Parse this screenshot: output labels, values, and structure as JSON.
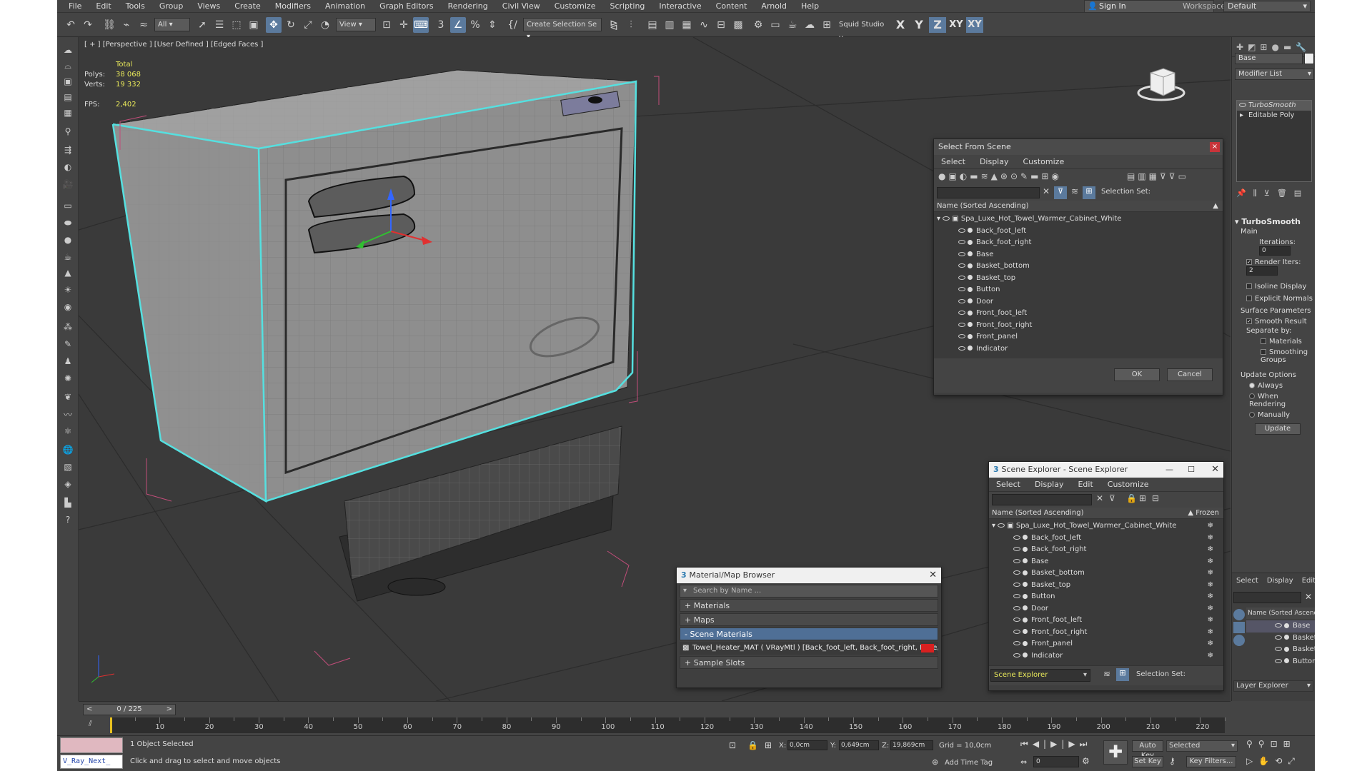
{
  "menu": [
    "File",
    "Edit",
    "Tools",
    "Group",
    "Views",
    "Create",
    "Modifiers",
    "Animation",
    "Graph Editors",
    "Rendering",
    "Civil View",
    "Customize",
    "Scripting",
    "Interactive",
    "Content",
    "Arnold",
    "Help"
  ],
  "signin": "Sign In",
  "workspaces": {
    "label": "Workspaces:",
    "value": "Default"
  },
  "toolbar": {
    "filter": "All",
    "refcoord": "View",
    "selection_set": "Create Selection Se",
    "squid": "Squid Studio v",
    "axes": [
      "X",
      "Y",
      "Z",
      "XY",
      "XY"
    ]
  },
  "viewport": {
    "label": "[ + ] [Perspective ] [User Defined ] [Edged Faces ]",
    "stats": {
      "total_label": "Total",
      "polys_label": "Polys:",
      "polys": "38 068",
      "verts_label": "Verts:",
      "verts": "19 332",
      "fps_label": "FPS:",
      "fps": "2,402"
    }
  },
  "select_from_scene": {
    "title": "Select From Scene",
    "menu": [
      "Select",
      "Display",
      "Customize"
    ],
    "selection_set_label": "Selection Set:",
    "column": "Name (Sorted Ascending)",
    "root": "Spa_Luxe_Hot_Towel_Warmer_Cabinet_White",
    "items": [
      "Back_foot_left",
      "Back_foot_right",
      "Base",
      "Basket_bottom",
      "Basket_top",
      "Button",
      "Door",
      "Front_foot_left",
      "Front_foot_right",
      "Front_panel",
      "Indicator"
    ],
    "ok": "OK",
    "cancel": "Cancel"
  },
  "scene_explorer": {
    "title": "Scene Explorer - Scene Explorer",
    "menu": [
      "Select",
      "Display",
      "Edit",
      "Customize"
    ],
    "column": "Name (Sorted Ascending)",
    "frozen": "▲ Frozen",
    "root": "Spa_Luxe_Hot_Towel_Warmer_Cabinet_White",
    "items": [
      "Back_foot_left",
      "Back_foot_right",
      "Base",
      "Basket_bottom",
      "Basket_top",
      "Button",
      "Door",
      "Front_foot_left",
      "Front_foot_right",
      "Front_panel",
      "Indicator"
    ],
    "footer_dropdown": "Scene Explorer",
    "selection_set_label": "Selection Set:"
  },
  "material_browser": {
    "title": "Material/Map Browser",
    "search_placeholder": "Search by Name ...",
    "sections": [
      "+ Materials",
      "+ Maps",
      "- Scene Materials"
    ],
    "material": "Towel_Heater_MAT ( VRayMtl ) [Back_foot_left, Back_foot_right, Base, Bask...",
    "sample_slots": "+ Sample Slots"
  },
  "command_panel": {
    "object_name": "Base",
    "modifier_list": "Modifier List",
    "stack": [
      "TurboSmooth",
      "Editable Poly"
    ],
    "turbosmooth": {
      "title": "TurboSmooth",
      "main": "Main",
      "iterations_label": "Iterations:",
      "iterations": "0",
      "render_iters_label": "Render Iters:",
      "render_iters": "2",
      "isoline": "Isoline Display",
      "explicit": "Explicit Normals",
      "surface": "Surface Parameters",
      "smooth_result": "Smooth Result",
      "separate": "Separate by:",
      "materials": "Materials",
      "smoothing_groups": "Smoothing Groups",
      "update_options": "Update Options",
      "always": "Always",
      "when_rendering": "When Rendering",
      "manually": "Manually",
      "update": "Update"
    }
  },
  "layer_explorer": {
    "menu": [
      "Select",
      "Display",
      "Edit"
    ],
    "column": "Name (Sorted Ascending)",
    "items": [
      "Base",
      "Basket_bottom",
      "Basket_top",
      "Button"
    ],
    "footer": "Layer Explorer"
  },
  "timeline": {
    "slider": "0 / 225",
    "ticks": [
      "10",
      "20",
      "30",
      "40",
      "50",
      "60",
      "70",
      "80",
      "90",
      "100",
      "110",
      "120",
      "130",
      "140",
      "150",
      "160",
      "170",
      "180",
      "190",
      "200",
      "210",
      "220"
    ]
  },
  "status": {
    "script": "V_Ray_Next_",
    "selected": "1 Object Selected",
    "hint": "Click and drag to select and move objects",
    "x_label": "X:",
    "x": "0,0cm",
    "y_label": "Y:",
    "y": "0,649cm",
    "z_label": "Z:",
    "z": "19,869cm",
    "grid": "Grid = 10,0cm",
    "add_time_tag": "Add Time Tag",
    "auto_key": "Auto Key",
    "set_key": "Set Key",
    "selected_dropdown": "Selected",
    "key_filters": "Key Filters...",
    "frame": "0"
  }
}
